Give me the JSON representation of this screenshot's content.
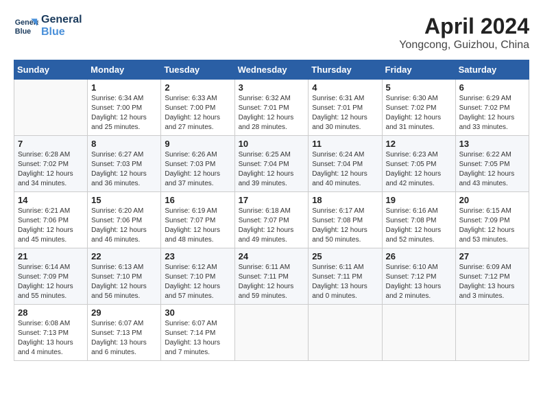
{
  "logo": {
    "line1": "General",
    "line2": "Blue"
  },
  "title": "April 2024",
  "location": "Yongcong, Guizhou, China",
  "days_of_week": [
    "Sunday",
    "Monday",
    "Tuesday",
    "Wednesday",
    "Thursday",
    "Friday",
    "Saturday"
  ],
  "weeks": [
    [
      {
        "day": "",
        "sunrise": "",
        "sunset": "",
        "daylight": ""
      },
      {
        "day": "1",
        "sunrise": "Sunrise: 6:34 AM",
        "sunset": "Sunset: 7:00 PM",
        "daylight": "Daylight: 12 hours and 25 minutes."
      },
      {
        "day": "2",
        "sunrise": "Sunrise: 6:33 AM",
        "sunset": "Sunset: 7:00 PM",
        "daylight": "Daylight: 12 hours and 27 minutes."
      },
      {
        "day": "3",
        "sunrise": "Sunrise: 6:32 AM",
        "sunset": "Sunset: 7:01 PM",
        "daylight": "Daylight: 12 hours and 28 minutes."
      },
      {
        "day": "4",
        "sunrise": "Sunrise: 6:31 AM",
        "sunset": "Sunset: 7:01 PM",
        "daylight": "Daylight: 12 hours and 30 minutes."
      },
      {
        "day": "5",
        "sunrise": "Sunrise: 6:30 AM",
        "sunset": "Sunset: 7:02 PM",
        "daylight": "Daylight: 12 hours and 31 minutes."
      },
      {
        "day": "6",
        "sunrise": "Sunrise: 6:29 AM",
        "sunset": "Sunset: 7:02 PM",
        "daylight": "Daylight: 12 hours and 33 minutes."
      }
    ],
    [
      {
        "day": "7",
        "sunrise": "Sunrise: 6:28 AM",
        "sunset": "Sunset: 7:02 PM",
        "daylight": "Daylight: 12 hours and 34 minutes."
      },
      {
        "day": "8",
        "sunrise": "Sunrise: 6:27 AM",
        "sunset": "Sunset: 7:03 PM",
        "daylight": "Daylight: 12 hours and 36 minutes."
      },
      {
        "day": "9",
        "sunrise": "Sunrise: 6:26 AM",
        "sunset": "Sunset: 7:03 PM",
        "daylight": "Daylight: 12 hours and 37 minutes."
      },
      {
        "day": "10",
        "sunrise": "Sunrise: 6:25 AM",
        "sunset": "Sunset: 7:04 PM",
        "daylight": "Daylight: 12 hours and 39 minutes."
      },
      {
        "day": "11",
        "sunrise": "Sunrise: 6:24 AM",
        "sunset": "Sunset: 7:04 PM",
        "daylight": "Daylight: 12 hours and 40 minutes."
      },
      {
        "day": "12",
        "sunrise": "Sunrise: 6:23 AM",
        "sunset": "Sunset: 7:05 PM",
        "daylight": "Daylight: 12 hours and 42 minutes."
      },
      {
        "day": "13",
        "sunrise": "Sunrise: 6:22 AM",
        "sunset": "Sunset: 7:05 PM",
        "daylight": "Daylight: 12 hours and 43 minutes."
      }
    ],
    [
      {
        "day": "14",
        "sunrise": "Sunrise: 6:21 AM",
        "sunset": "Sunset: 7:06 PM",
        "daylight": "Daylight: 12 hours and 45 minutes."
      },
      {
        "day": "15",
        "sunrise": "Sunrise: 6:20 AM",
        "sunset": "Sunset: 7:06 PM",
        "daylight": "Daylight: 12 hours and 46 minutes."
      },
      {
        "day": "16",
        "sunrise": "Sunrise: 6:19 AM",
        "sunset": "Sunset: 7:07 PM",
        "daylight": "Daylight: 12 hours and 48 minutes."
      },
      {
        "day": "17",
        "sunrise": "Sunrise: 6:18 AM",
        "sunset": "Sunset: 7:07 PM",
        "daylight": "Daylight: 12 hours and 49 minutes."
      },
      {
        "day": "18",
        "sunrise": "Sunrise: 6:17 AM",
        "sunset": "Sunset: 7:08 PM",
        "daylight": "Daylight: 12 hours and 50 minutes."
      },
      {
        "day": "19",
        "sunrise": "Sunrise: 6:16 AM",
        "sunset": "Sunset: 7:08 PM",
        "daylight": "Daylight: 12 hours and 52 minutes."
      },
      {
        "day": "20",
        "sunrise": "Sunrise: 6:15 AM",
        "sunset": "Sunset: 7:09 PM",
        "daylight": "Daylight: 12 hours and 53 minutes."
      }
    ],
    [
      {
        "day": "21",
        "sunrise": "Sunrise: 6:14 AM",
        "sunset": "Sunset: 7:09 PM",
        "daylight": "Daylight: 12 hours and 55 minutes."
      },
      {
        "day": "22",
        "sunrise": "Sunrise: 6:13 AM",
        "sunset": "Sunset: 7:10 PM",
        "daylight": "Daylight: 12 hours and 56 minutes."
      },
      {
        "day": "23",
        "sunrise": "Sunrise: 6:12 AM",
        "sunset": "Sunset: 7:10 PM",
        "daylight": "Daylight: 12 hours and 57 minutes."
      },
      {
        "day": "24",
        "sunrise": "Sunrise: 6:11 AM",
        "sunset": "Sunset: 7:11 PM",
        "daylight": "Daylight: 12 hours and 59 minutes."
      },
      {
        "day": "25",
        "sunrise": "Sunrise: 6:11 AM",
        "sunset": "Sunset: 7:11 PM",
        "daylight": "Daylight: 13 hours and 0 minutes."
      },
      {
        "day": "26",
        "sunrise": "Sunrise: 6:10 AM",
        "sunset": "Sunset: 7:12 PM",
        "daylight": "Daylight: 13 hours and 2 minutes."
      },
      {
        "day": "27",
        "sunrise": "Sunrise: 6:09 AM",
        "sunset": "Sunset: 7:12 PM",
        "daylight": "Daylight: 13 hours and 3 minutes."
      }
    ],
    [
      {
        "day": "28",
        "sunrise": "Sunrise: 6:08 AM",
        "sunset": "Sunset: 7:13 PM",
        "daylight": "Daylight: 13 hours and 4 minutes."
      },
      {
        "day": "29",
        "sunrise": "Sunrise: 6:07 AM",
        "sunset": "Sunset: 7:13 PM",
        "daylight": "Daylight: 13 hours and 6 minutes."
      },
      {
        "day": "30",
        "sunrise": "Sunrise: 6:07 AM",
        "sunset": "Sunset: 7:14 PM",
        "daylight": "Daylight: 13 hours and 7 minutes."
      },
      {
        "day": "",
        "sunrise": "",
        "sunset": "",
        "daylight": ""
      },
      {
        "day": "",
        "sunrise": "",
        "sunset": "",
        "daylight": ""
      },
      {
        "day": "",
        "sunrise": "",
        "sunset": "",
        "daylight": ""
      },
      {
        "day": "",
        "sunrise": "",
        "sunset": "",
        "daylight": ""
      }
    ]
  ]
}
